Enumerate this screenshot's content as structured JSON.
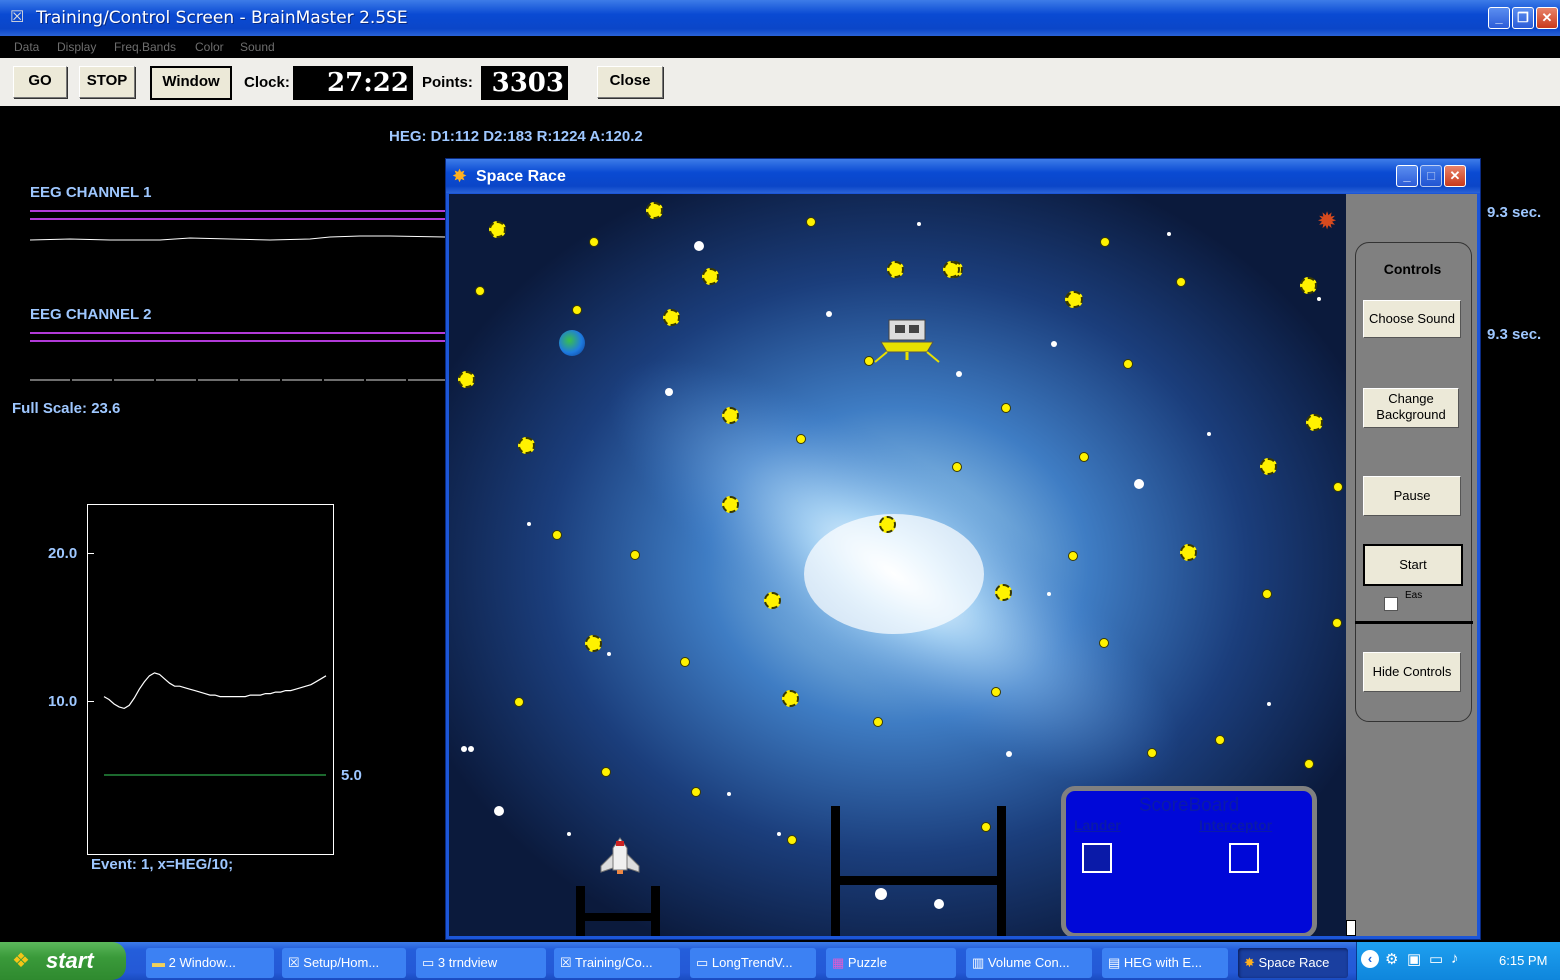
{
  "window": {
    "title": "Training/Control Screen - BrainMaster 2.5SE",
    "icon": "brainmaster-app-icon"
  },
  "menu": [
    "Data",
    "Display",
    "Freq.Bands",
    "Color",
    "Sound"
  ],
  "toolbar": {
    "go_label": "GO",
    "stop_label": "STOP",
    "window_label": "Window",
    "clock_label": "Clock:",
    "clock_value": "27:22",
    "points_label": "Points:",
    "points_value": "3303",
    "close_label": "Close"
  },
  "heg_readout": "HEG: D1:112 D2:183 R:1224 A:120.2",
  "eeg": {
    "channel1_label": "EEG CHANNEL 1",
    "channel2_label": "EEG CHANNEL 2",
    "channel1_time": "9.3 sec.",
    "channel2_time": "9.3 sec.",
    "full_scale": "Full Scale: 23.6"
  },
  "trend": {
    "y_top": "20.0",
    "y_mid": "10.0",
    "threshold": "5.0",
    "event_text": "Event: 1, x=HEG/10;"
  },
  "chart_data": {
    "type": "line",
    "ylim": [
      0,
      23.6
    ],
    "x": [
      0,
      1,
      2,
      3,
      4,
      5,
      6,
      7,
      8,
      9,
      10,
      11,
      12,
      13,
      14,
      15,
      16,
      17,
      18,
      19,
      20,
      21,
      22,
      23,
      24,
      25,
      26,
      27,
      28,
      29,
      30,
      31,
      32,
      33,
      34,
      35,
      36,
      37,
      38,
      39,
      40,
      41,
      42,
      43,
      44
    ],
    "series": [
      {
        "values": [
          10.3,
          10.1,
          9.8,
          9.6,
          9.5,
          9.7,
          10.2,
          10.8,
          11.3,
          11.7,
          11.9,
          11.8,
          11.5,
          11.2,
          11.0,
          11.0,
          10.9,
          10.8,
          10.7,
          10.6,
          10.5,
          10.4,
          10.4,
          10.3,
          10.3,
          10.3,
          10.3,
          10.3,
          10.3,
          10.4,
          10.4,
          10.4,
          10.5,
          10.5,
          10.6,
          10.6,
          10.7,
          10.7,
          10.8,
          10.9,
          11.0,
          11.1,
          11.3,
          11.5,
          11.7
        ]
      },
      {
        "values": [
          5.0,
          5.0,
          5.0,
          5.0,
          5.0,
          5.0,
          5.0,
          5.0,
          5.0,
          5.0,
          5.0,
          5.0,
          5.0,
          5.0,
          5.0,
          5.0,
          5.0,
          5.0,
          5.0,
          5.0,
          5.0,
          5.0,
          5.0,
          5.0,
          5.0,
          5.0,
          5.0,
          5.0,
          5.0,
          5.0,
          5.0,
          5.0,
          5.0,
          5.0,
          5.0,
          5.0,
          5.0,
          5.0,
          5.0,
          5.0,
          5.0,
          5.0,
          5.0,
          5.0,
          5.0
        ]
      }
    ],
    "colors": [
      "#ffffff",
      "#2ea84a"
    ]
  },
  "space_race": {
    "title": "Space Race",
    "controls_title": "Controls",
    "choose_sound": "Choose Sound",
    "change_background_1": "Change",
    "change_background_2": "Background",
    "pause": "Pause",
    "start": "Start",
    "checkbox_label": "Eas",
    "hide_controls": "Hide Controls",
    "scoreboard_title": "ScoreBoard",
    "lander_label": "Lander",
    "interceptor_label": "Interceptor"
  },
  "taskbar": {
    "start": "start",
    "items": [
      "2 Window...",
      "Setup/Hom...",
      "3 trndview",
      "Training/Co...",
      "LongTrendV...",
      "Puzzle",
      "Volume Con...",
      "HEG with E...",
      "Space Race"
    ],
    "clock": "6:15 PM"
  },
  "colors": {
    "title_blue": "#0a4ad3",
    "magenta": "#b23ad8",
    "readout_blue": "#9ec7ff",
    "scoreboard_blue": "#0008d8"
  }
}
